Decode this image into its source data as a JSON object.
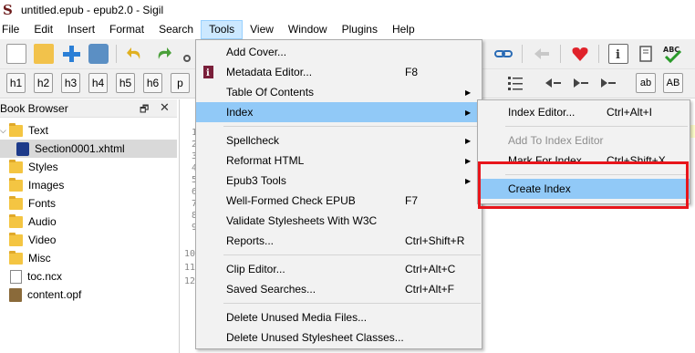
{
  "window": {
    "title": "untitled.epub - epub2.0 - Sigil"
  },
  "menubar": {
    "items": [
      "File",
      "Edit",
      "Insert",
      "Format",
      "Search",
      "Tools",
      "View",
      "Window",
      "Plugins",
      "Help"
    ],
    "active": "Tools"
  },
  "heading_buttons": [
    "h1",
    "h2",
    "h3",
    "h4",
    "h5",
    "h6",
    "p"
  ],
  "right_buttons": {
    "ab1": "ab",
    "ab2": "AB"
  },
  "book_browser": {
    "title": "Book Browser",
    "items": [
      {
        "label": "Text",
        "kind": "folder",
        "expanded": true
      },
      {
        "label": "Section0001.xhtml",
        "kind": "xhtml",
        "selected": true
      },
      {
        "label": "Styles",
        "kind": "folder"
      },
      {
        "label": "Images",
        "kind": "folder"
      },
      {
        "label": "Fonts",
        "kind": "folder"
      },
      {
        "label": "Audio",
        "kind": "folder"
      },
      {
        "label": "Video",
        "kind": "folder"
      },
      {
        "label": "Misc",
        "kind": "folder"
      },
      {
        "label": "toc.ncx",
        "kind": "file"
      },
      {
        "label": "content.opf",
        "kind": "opf"
      }
    ]
  },
  "editor": {
    "line_numbers": [
      "1",
      "2",
      "3",
      "4",
      "5",
      "6",
      "7",
      "8",
      "9",
      "10",
      "11",
      "12"
    ]
  },
  "tools_menu": {
    "items": [
      {
        "label": "Add Cover...",
        "shortcut": ""
      },
      {
        "label": "Metadata Editor...",
        "shortcut": "F8"
      },
      {
        "label": "Table Of Contents",
        "submenu": true
      },
      {
        "label": "Index",
        "submenu": true,
        "highlighted": true
      },
      {
        "label": "Spellcheck",
        "submenu": true
      },
      {
        "label": "Reformat HTML",
        "submenu": true
      },
      {
        "label": "Epub3 Tools",
        "submenu": true
      },
      {
        "label": "Well-Formed Check EPUB",
        "shortcut": "F7"
      },
      {
        "label": "Validate Stylesheets With W3C",
        "shortcut": ""
      },
      {
        "label": "Reports...",
        "shortcut": "Ctrl+Shift+R"
      },
      {
        "label": "Clip Editor...",
        "shortcut": "Ctrl+Alt+C"
      },
      {
        "label": "Saved Searches...",
        "shortcut": "Ctrl+Alt+F"
      },
      {
        "label": "Delete Unused Media Files...",
        "shortcut": ""
      },
      {
        "label": "Delete Unused Stylesheet Classes...",
        "shortcut": ""
      }
    ]
  },
  "index_menu": {
    "items": [
      {
        "label": "Index Editor...",
        "shortcut": "Ctrl+Alt+I"
      },
      {
        "label": "Add To Index Editor",
        "shortcut": "",
        "disabled": true
      },
      {
        "label": "Mark For Index",
        "shortcut": "Ctrl+Shift+X"
      },
      {
        "label": "Create Index",
        "shortcut": "",
        "highlighted": true
      }
    ]
  },
  "colors": {
    "highlight": "#91c9f7",
    "annotation_box": "#e8151b",
    "menu_bg": "#f2f2f2"
  }
}
